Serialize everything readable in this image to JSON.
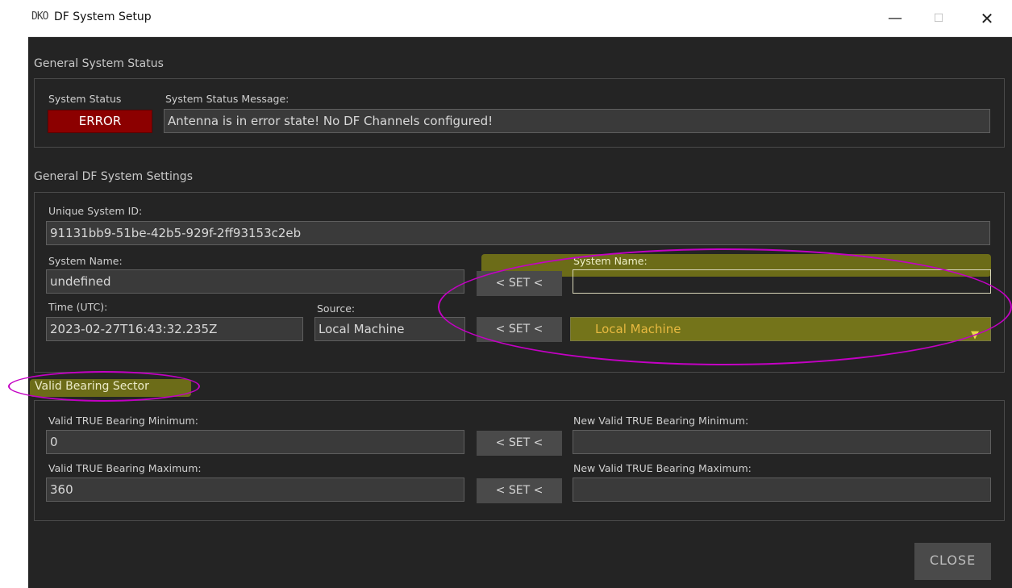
{
  "window": {
    "title": "DF System Setup",
    "logo_text": "DKO",
    "minimize_glyph": "—",
    "maximize_glyph": "☐",
    "close_glyph": "✕"
  },
  "general_status": {
    "title": "General System Status",
    "status_label": "System Status",
    "status_value": "ERROR",
    "status_color": "#8c0000",
    "message_label": "System Status Message:",
    "message_value": "Antenna is in error state! No DF Channels configured!"
  },
  "settings": {
    "title": "General DF System Settings",
    "id_label": "Unique System ID:",
    "id_value": "91131bb9-51be-42b5-929f-2ff93153c2eb",
    "name_label": "System Name:",
    "name_value": "undefined",
    "name_set_label": "< SET <",
    "new_name_label": "System Name:",
    "new_name_value": "",
    "time_label": "Time (UTC):",
    "time_value": "2023-02-27T16:43:32.235Z",
    "source_label": "Source:",
    "source_value": "Local Machine",
    "source_set_label": "< SET <",
    "new_source_value": "Local Machine",
    "dropdown_arrow": "▼"
  },
  "bearing": {
    "title": "Valid Bearing Sector",
    "min_label": "Valid TRUE Bearing Minimum:",
    "min_value": "0",
    "min_set_label": "< SET <",
    "new_min_label": "New Valid TRUE Bearing Minimum:",
    "new_min_value": "",
    "max_label": "Valid TRUE Bearing Maximum:",
    "max_value": "360",
    "max_set_label": "< SET <",
    "new_max_label": "New Valid TRUE Bearing Maximum:",
    "new_max_value": ""
  },
  "footer": {
    "close_label": "CLOSE"
  },
  "colors": {
    "annotation_ellipse": "#c400c4",
    "highlight": "#808014",
    "background": "#242424"
  }
}
